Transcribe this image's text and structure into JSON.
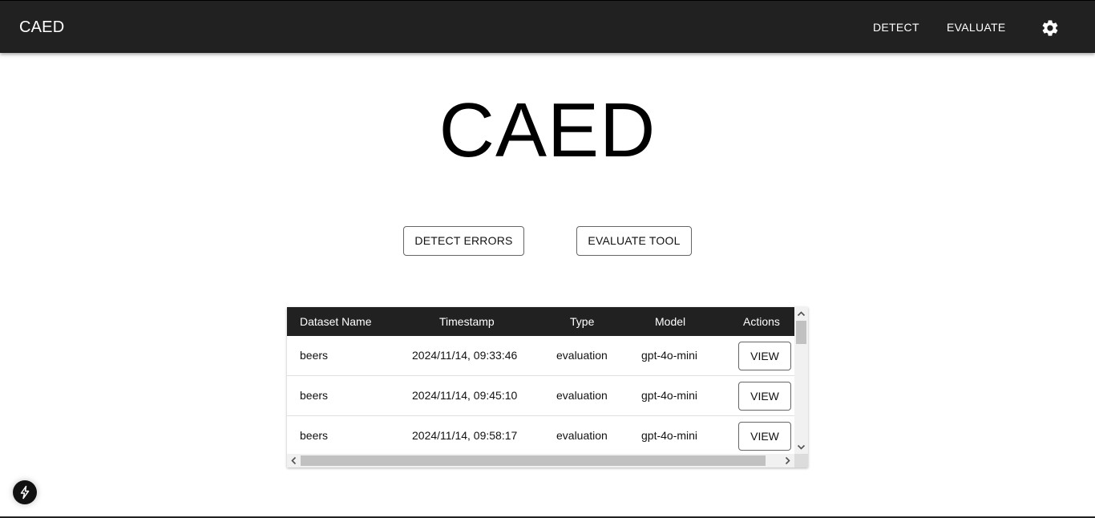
{
  "app": {
    "brand": "CAED",
    "nav": [
      "DETECT",
      "EVALUATE"
    ],
    "settings_icon": "gear-icon"
  },
  "hero": {
    "title": "CAED"
  },
  "actions": {
    "detect_label": "DETECT ERRORS",
    "evaluate_label": "EVALUATE TOOL"
  },
  "table": {
    "columns": [
      "Dataset Name",
      "Timestamp",
      "Type",
      "Model",
      "Actions"
    ],
    "rows": [
      {
        "name": "beers",
        "timestamp": "2024/11/14, 09:33:46",
        "type": "evaluation",
        "model": "gpt-4o-mini",
        "action": "VIEW"
      },
      {
        "name": "beers",
        "timestamp": "2024/11/14, 09:45:10",
        "type": "evaluation",
        "model": "gpt-4o-mini",
        "action": "VIEW"
      },
      {
        "name": "beers",
        "timestamp": "2024/11/14, 09:58:17",
        "type": "evaluation",
        "model": "gpt-4o-mini",
        "action": "VIEW"
      }
    ]
  },
  "fab": {
    "icon": "lightning-icon"
  }
}
